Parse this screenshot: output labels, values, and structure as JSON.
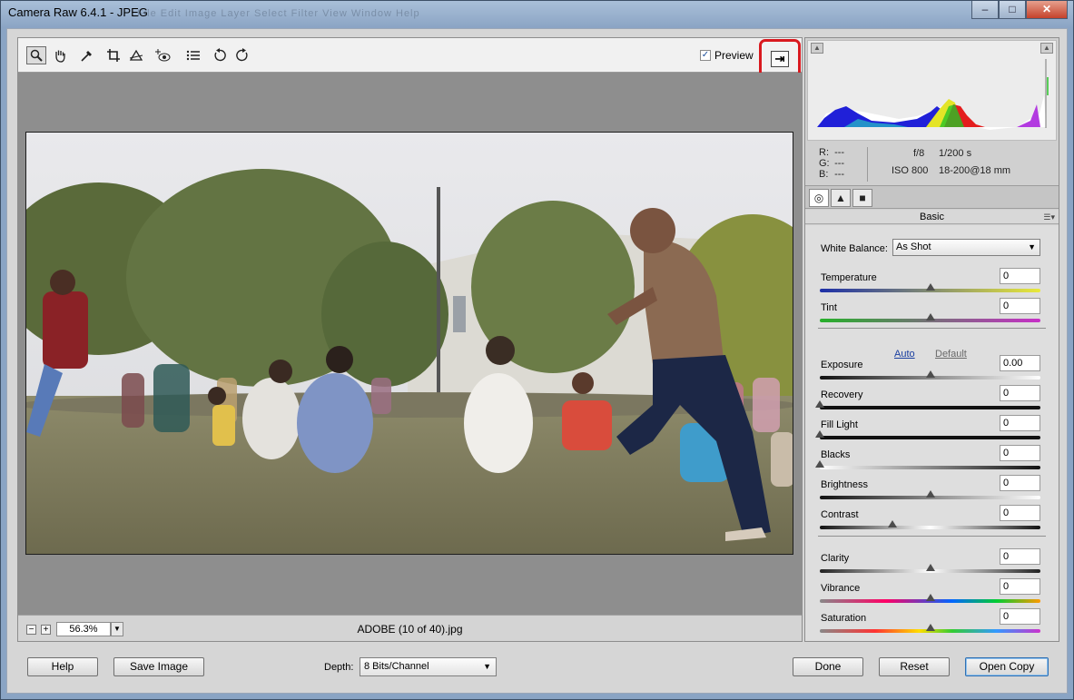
{
  "window": {
    "title": "Camera Raw 6.4.1  -  JPEG",
    "background_menu": "File   Edit   Image   Layer   Select   Filter   View   Window   Help",
    "min": "–",
    "max": "□",
    "close": "✕"
  },
  "toolbar": {
    "tools": [
      "zoom-tool",
      "hand-tool",
      "white-balance-tool",
      "crop-tool",
      "straighten-tool",
      "red-eye-tool",
      "preferences-tool",
      "rotate-ccw-tool",
      "rotate-cw-tool"
    ],
    "preview_label": "Preview",
    "preview_checked": true,
    "fullscreen_icon": "⇥"
  },
  "status": {
    "zoom_out": "−",
    "zoom_in": "+",
    "zoom_value": "56.3%",
    "filename": "ADOBE (10 of 40).jpg"
  },
  "info": {
    "r_label": "R:",
    "r_value": "---",
    "g_label": "G:",
    "g_value": "---",
    "b_label": "B:",
    "b_value": "---",
    "aperture": "f/8",
    "shutter": "1/200 s",
    "iso": "ISO 800",
    "lens": "18-200@18 mm"
  },
  "panel": {
    "section_title": "Basic",
    "white_balance_label": "White Balance:",
    "white_balance_value": "As Shot",
    "auto_link": "Auto",
    "default_link": "Default",
    "sliders": [
      {
        "label": "Temperature",
        "value": "0",
        "pos": 0.5
      },
      {
        "label": "Tint",
        "value": "0",
        "pos": 0.5
      },
      {
        "label": "Exposure",
        "value": "0.00",
        "pos": 0.5
      },
      {
        "label": "Recovery",
        "value": "0",
        "pos": 0.0
      },
      {
        "label": "Fill Light",
        "value": "0",
        "pos": 0.0
      },
      {
        "label": "Blacks",
        "value": "0",
        "pos": 0.0
      },
      {
        "label": "Brightness",
        "value": "0",
        "pos": 0.5
      },
      {
        "label": "Contrast",
        "value": "0",
        "pos": 0.33
      },
      {
        "label": "Clarity",
        "value": "0",
        "pos": 0.5
      },
      {
        "label": "Vibrance",
        "value": "0",
        "pos": 0.5
      },
      {
        "label": "Saturation",
        "value": "0",
        "pos": 0.5
      }
    ]
  },
  "footer": {
    "help": "Help",
    "save_image": "Save Image",
    "depth_label": "Depth:",
    "depth_value": "8 Bits/Channel",
    "done": "Done",
    "reset": "Reset",
    "open_copy": "Open Copy"
  }
}
